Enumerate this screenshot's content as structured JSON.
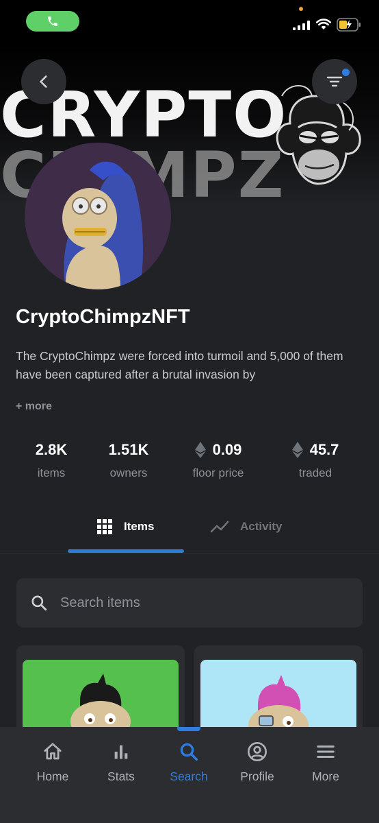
{
  "status_bar": {
    "icons": [
      "phone-icon",
      "signal-icon",
      "wifi-icon",
      "battery-icon"
    ]
  },
  "header": {
    "banner_line1": "CRYPTO",
    "banner_line2": "CHIMPZ",
    "back_icon": "chevron-left-icon",
    "filter_icon": "filter-icon"
  },
  "collection": {
    "name": "CryptoChimpzNFT",
    "description": "The CryptoChimpz were forced into turmoil and 5,000 of them have been captured after a brutal invasion by",
    "more_label": "+ more"
  },
  "stats": [
    {
      "value": "2.8K",
      "label": "items"
    },
    {
      "value": "1.51K",
      "label": "owners"
    },
    {
      "value": "0.09",
      "label": "floor price",
      "icon": "eth-icon"
    },
    {
      "value": "45.7",
      "label": "traded",
      "icon": "eth-icon"
    }
  ],
  "tabs": {
    "items_label": "Items",
    "activity_label": "Activity",
    "active": "Items"
  },
  "search": {
    "placeholder": "Search items",
    "value": ""
  },
  "cards": [
    {
      "background": "#56c04f"
    },
    {
      "background": "#aee6f7"
    }
  ],
  "bottom_nav": {
    "home": "Home",
    "stats": "Stats",
    "search": "Search",
    "profile": "Profile",
    "more": "More",
    "active": "Search"
  },
  "colors": {
    "accent": "#2f7de0",
    "background": "#202225",
    "surface": "#2b2d31",
    "call_green": "#5fd068"
  }
}
